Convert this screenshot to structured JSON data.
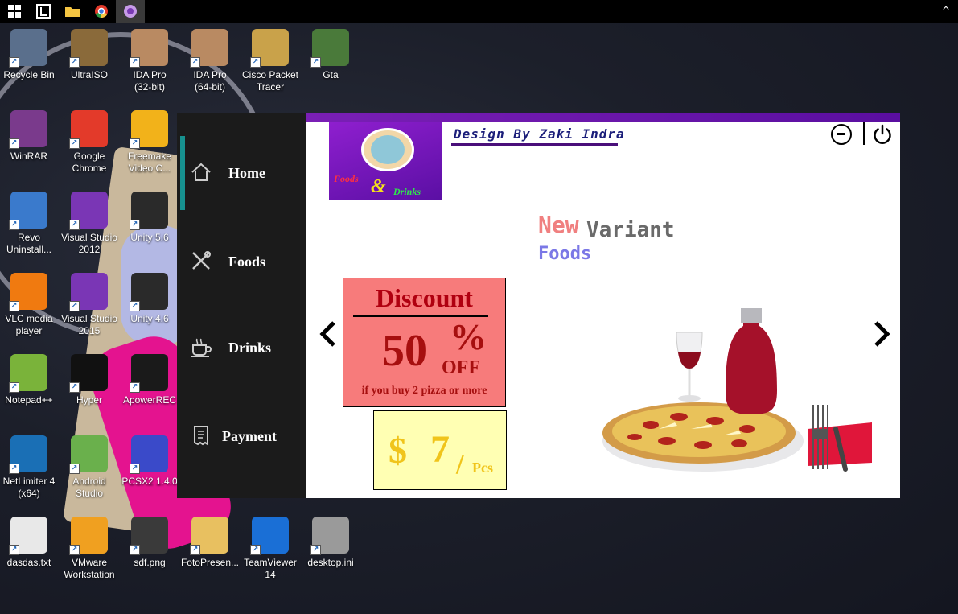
{
  "desktop": {
    "icons": [
      {
        "label": "Recycle Bin",
        "icon": "recycle-bin-icon",
        "color": "#5a6f8c"
      },
      {
        "label": "UltraISO",
        "icon": "disc-icon",
        "color": "#8a6a3a"
      },
      {
        "label": "IDA Pro\n(32-bit)",
        "icon": "ida-icon",
        "color": "#b98a62"
      },
      {
        "label": "IDA Pro\n(64-bit)",
        "icon": "ida64-icon",
        "color": "#b98a62"
      },
      {
        "label": "Cisco Packet\nTracer",
        "icon": "packet-tracer-icon",
        "color": "#c9a24a"
      },
      {
        "label": "Gta",
        "icon": "gta-icon",
        "color": "#4a7a3a"
      },
      {
        "label": "WinRAR",
        "icon": "winrar-icon",
        "color": "#7a3a8c"
      },
      {
        "label": "Google\nChrome",
        "icon": "chrome-icon",
        "color": "#e33a2a"
      },
      {
        "label": "Freemake\nVideo C...",
        "icon": "freemake-icon",
        "color": "#f2b21a"
      },
      {
        "label": "Revo\nUninstall...",
        "icon": "revo-icon",
        "color": "#3a7acc"
      },
      {
        "label": "Visual Studio\n2012",
        "icon": "visual-studio-icon",
        "color": "#7a36b5"
      },
      {
        "label": "Unity 5.6",
        "icon": "unity-icon",
        "color": "#2a2a2a"
      },
      {
        "label": "VLC media\nplayer",
        "icon": "vlc-icon",
        "color": "#f07a10"
      },
      {
        "label": "Visual Studio\n2015",
        "icon": "visual-studio-icon",
        "color": "#7a36b5"
      },
      {
        "label": "Unity 4.6",
        "icon": "unity-icon",
        "color": "#2a2a2a"
      },
      {
        "label": "Notepad++",
        "icon": "notepad-plus-icon",
        "color": "#7ab33a"
      },
      {
        "label": "Hyper",
        "icon": "hyper-icon",
        "color": "#111111"
      },
      {
        "label": "ApowerREC",
        "icon": "record-icon",
        "color": "#1a1a1a"
      },
      {
        "label": "NetLimiter 4\n(x64)",
        "icon": "netlimiter-icon",
        "color": "#1a6fb5"
      },
      {
        "label": "Android\nStudio",
        "icon": "android-studio-icon",
        "color": "#6ab04c"
      },
      {
        "label": "PCSX2 1.4.0",
        "icon": "pcsx2-icon",
        "color": "#3a4ac9"
      },
      {
        "label": "dasdas.txt",
        "icon": "text-file-icon",
        "color": "#e8e8e8"
      },
      {
        "label": "VMware\nWorkstation",
        "icon": "vmware-icon",
        "color": "#f0a020"
      },
      {
        "label": "sdf.png",
        "icon": "image-file-icon",
        "color": "#3a3a3a"
      },
      {
        "label": "FotoPresen...",
        "icon": "folder-icon",
        "color": "#e8c060"
      },
      {
        "label": "TeamViewer\n14",
        "icon": "teamviewer-icon",
        "color": "#1a6fd6"
      },
      {
        "label": "desktop.ini",
        "icon": "settings-file-icon",
        "color": "#9a9a9a"
      }
    ]
  },
  "taskbar": {
    "items": [
      "windows-start-icon",
      "netlimiter-icon",
      "file-explorer-icon",
      "chrome-icon",
      "app-icon"
    ]
  },
  "app": {
    "nav": [
      {
        "label": "Home",
        "icon": "home-icon"
      },
      {
        "label": "Foods",
        "icon": "utensils-icon"
      },
      {
        "label": "Drinks",
        "icon": "coffee-cup-icon"
      },
      {
        "label": "Payment",
        "icon": "receipt-icon"
      }
    ],
    "logo": {
      "line1": "Foods",
      "line2": "&",
      "line3": "Drinks"
    },
    "designer": "Design By Zaki Indra",
    "headline": {
      "new": "New",
      "variant": "Variant",
      "foods": "Foods"
    },
    "discount": {
      "title": "Discount",
      "amount": "50",
      "percent": "%",
      "off": "OFF",
      "note": "if you buy 2 pizza or more"
    },
    "price": {
      "currency": "$",
      "value": "7",
      "slash": "/",
      "unit": "Pcs"
    },
    "colors": {
      "accent": "#7a1fb5",
      "sidebar": "#1b1b1b",
      "indicator": "#17918f"
    }
  }
}
